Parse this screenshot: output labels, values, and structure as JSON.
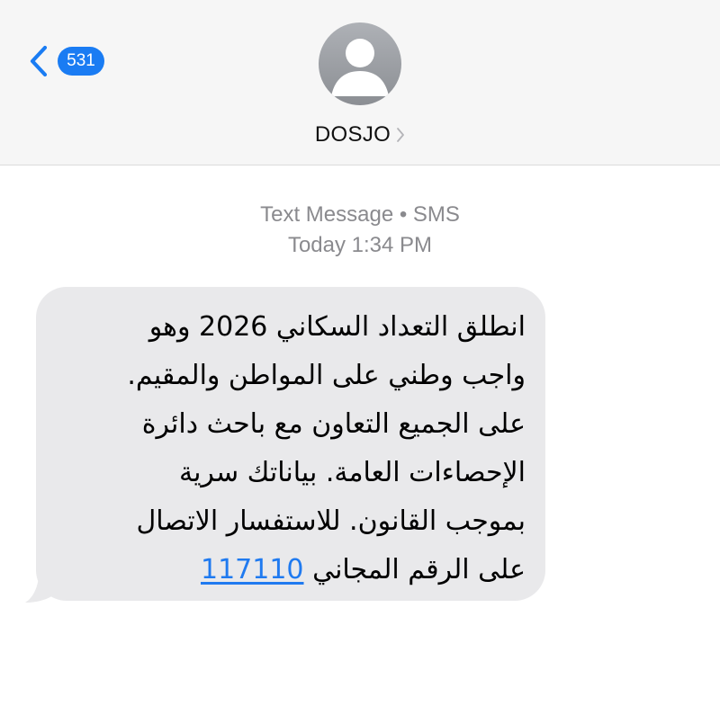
{
  "header": {
    "back_badge_count": "531",
    "contact_name": "DOSJO",
    "accent_color": "#1a7cf3",
    "icons": {
      "back": "chevron-left-icon",
      "avatar": "person-icon",
      "details": "chevron-right-icon"
    }
  },
  "meta": {
    "service": "Text Message • SMS",
    "timestamp": "Today 1:34 PM"
  },
  "message": {
    "lines": [
      "انطلق التعداد السكاني 2026 وهو",
      "واجب وطني على المواطن والمقيم.",
      "على الجميع التعاون مع باحث دائرة",
      "الإحصاءات العامة. بياناتك سرية",
      "بموجب القانون. للاستفسار الاتصال"
    ],
    "last_line_prefix": "على الرقم المجاني",
    "phone_number": "117110",
    "bubble_color": "#e9e9eb",
    "link_color": "#1f7af0"
  }
}
